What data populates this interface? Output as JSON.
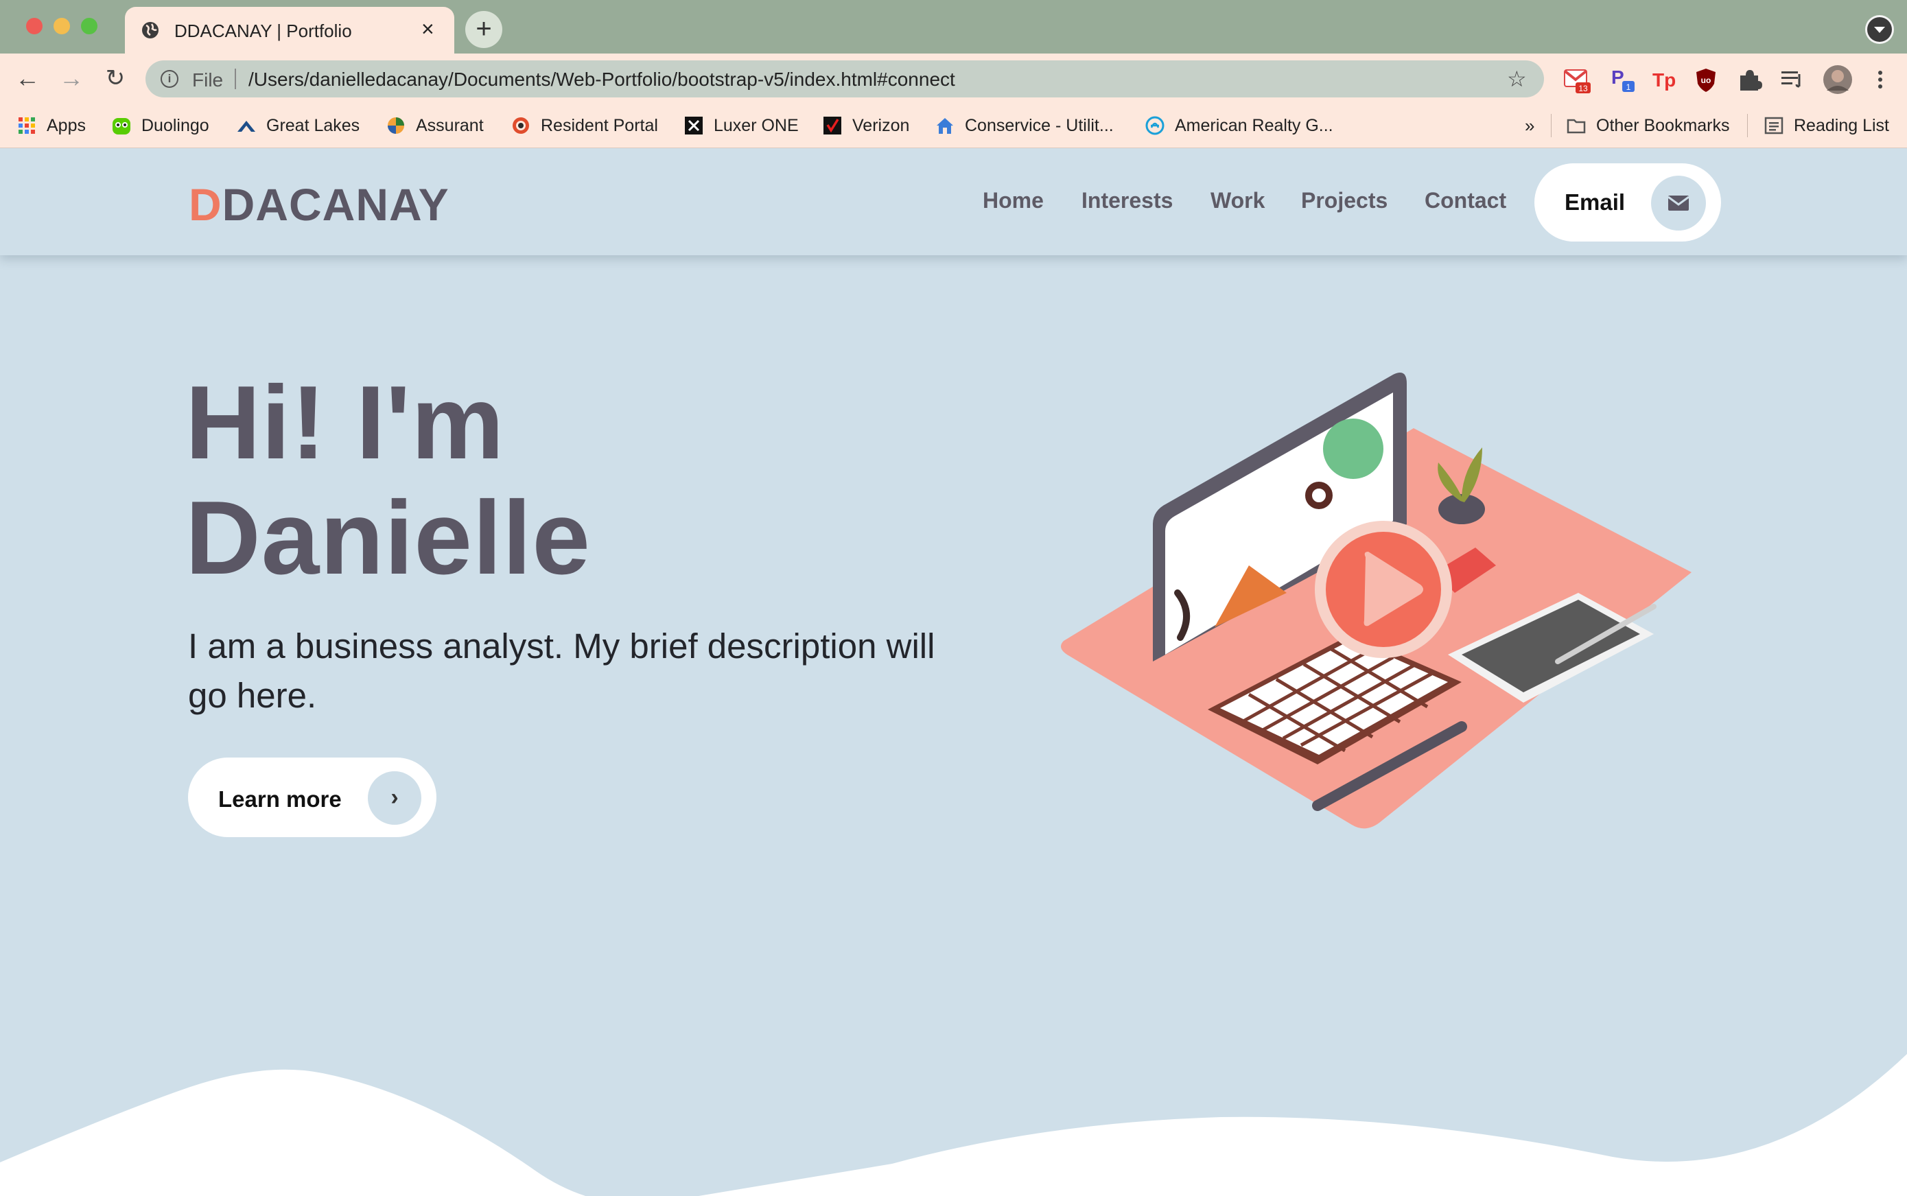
{
  "browser": {
    "tab": {
      "title": "DDACANAY | Portfolio"
    },
    "address": {
      "scheme_label": "File",
      "url": "/Users/danielledacanay/Documents/Web-Portfolio/bootstrap-v5/index.html#connect"
    },
    "extensions": [
      {
        "icon": "gmail-icon",
        "badge": "13"
      },
      {
        "icon": "p-extension-icon",
        "badge": "1"
      },
      {
        "icon": "tp-extension-icon"
      },
      {
        "icon": "ublock-icon"
      },
      {
        "icon": "puzzle-icon"
      },
      {
        "icon": "reading-queue-icon"
      },
      {
        "icon": "profile-avatar"
      },
      {
        "icon": "more-icon"
      }
    ],
    "bookmarks": [
      {
        "label": "Apps",
        "icon": "apps-grid-icon"
      },
      {
        "label": "Duolingo",
        "icon": "duolingo-icon"
      },
      {
        "label": "Great Lakes",
        "icon": "great-lakes-icon"
      },
      {
        "label": "Assurant",
        "icon": "assurant-icon"
      },
      {
        "label": "Resident Portal",
        "icon": "resident-portal-icon"
      },
      {
        "label": "Luxer ONE",
        "icon": "luxer-icon"
      },
      {
        "label": "Verizon",
        "icon": "verizon-icon"
      },
      {
        "label": "Conservice - Utilit...",
        "icon": "home-icon"
      },
      {
        "label": "American Realty G...",
        "icon": "american-realty-icon"
      }
    ],
    "bookmarks_overflow": "»",
    "other_bookmarks": "Other Bookmarks",
    "reading_list": "Reading List"
  },
  "site": {
    "logo": {
      "first": "D",
      "rest": "DACANAY"
    },
    "nav": [
      "Home",
      "Interests",
      "Work",
      "Projects",
      "Contact"
    ],
    "email_button": "Email",
    "hero": {
      "title_line1": "Hi! I'm",
      "title_line2": "Danielle",
      "description": "I am a business analyst. My brief description will go here.",
      "cta": "Learn more"
    }
  },
  "colors": {
    "page_bg": "#cfdfe9",
    "accent": "#ef7a61",
    "heading": "#5b5765",
    "tabbar": "#98ac98",
    "chrome": "#fde8dd"
  }
}
